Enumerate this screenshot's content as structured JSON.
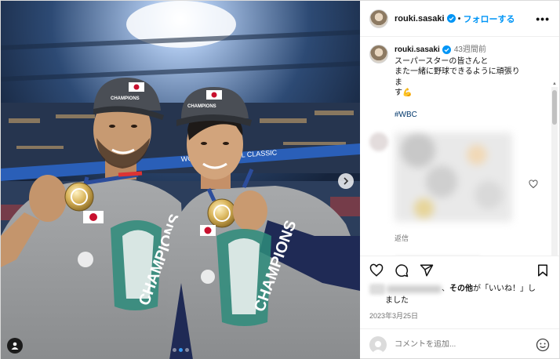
{
  "header": {
    "username": "rouki.sasaki",
    "separator": "•",
    "follow_label": "フォローする",
    "more_label": "•••"
  },
  "caption": {
    "username": "rouki.sasaki",
    "time_ago": "43週間前",
    "text": "スーパースターの皆さんと\nまた一緒に野球できるように頑張りま\nす💪",
    "hashtag": "#WBC"
  },
  "comment": {
    "reply_label": "返信"
  },
  "likes": {
    "text_prefix": "、",
    "others": "その他",
    "text_suffix": "が「いいね！」し",
    "text_line2": "ました"
  },
  "post_date": "2023年3月25日",
  "add_comment": {
    "placeholder": "コメントを追加..."
  },
  "photo": {
    "banner_text": "WORLD BASEBALL CLASSIC",
    "shirt_text": "CHAMPIONS",
    "cap_text": "CHAMPIONS"
  },
  "colors": {
    "link_blue": "#0095f6",
    "verified_blue": "#0095f6",
    "hashtag": "#00376b",
    "active_dot": "#3897f0"
  },
  "icons": [
    "verified-icon",
    "more-icon",
    "heart-icon",
    "comment-icon",
    "share-icon",
    "bookmark-icon",
    "emoji-icon",
    "next-arrow-icon",
    "tag-user-icon"
  ],
  "carousel": {
    "total": 3,
    "active_index": 1
  }
}
